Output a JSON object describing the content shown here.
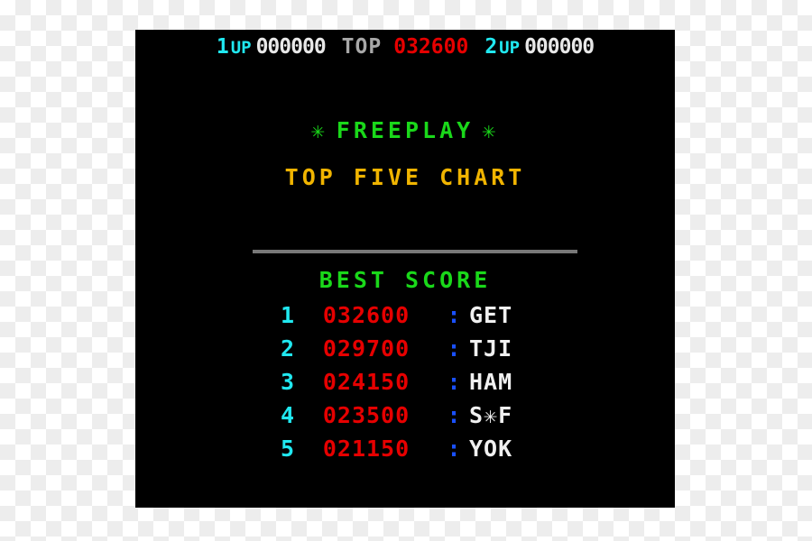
{
  "screen": {
    "background_color": "#000000"
  },
  "status_bar": {
    "player1": {
      "label_num": "1",
      "label_up": "UP",
      "score": "000000",
      "label_color": "#20e8f0",
      "score_color": "#e8e8e8"
    },
    "top": {
      "label": "TOP",
      "score": "032600",
      "label_color": "#a8a8a8",
      "score_color": "#e60000"
    },
    "player2": {
      "label_num": "2",
      "label_up": "UP",
      "score": "000000",
      "label_color": "#20e8f0",
      "score_color": "#e8e8e8"
    }
  },
  "freeplay": {
    "star_left": "✳",
    "text": "FREEPLAY",
    "star_right": "✳",
    "color": "#1ad81a"
  },
  "chart_title": {
    "text": "TOP FIVE CHART",
    "color": "#f0b400"
  },
  "divider": {
    "color": "#787878"
  },
  "best_score_heading": {
    "text": "BEST SCORE",
    "color": "#1ad81a"
  },
  "score_table": {
    "separator": ":",
    "rank_color": "#20e8f0",
    "score_color": "#e60000",
    "separator_color": "#1a50ff",
    "initials_color": "#f0f0f0",
    "rows": [
      {
        "rank": "1",
        "score": "032600",
        "sep": ":",
        "initials": "GET"
      },
      {
        "rank": "2",
        "score": "029700",
        "sep": ":",
        "initials": "TJI"
      },
      {
        "rank": "3",
        "score": "024150",
        "sep": ":",
        "initials": "HAM"
      },
      {
        "rank": "4",
        "score": "023500",
        "sep": ":",
        "initials": "S✳F"
      },
      {
        "rank": "5",
        "score": "021150",
        "sep": ":",
        "initials": "YOK"
      }
    ]
  }
}
